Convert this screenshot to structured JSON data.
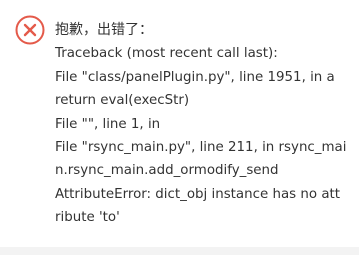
{
  "dialog": {
    "icon": "error-circle-x-icon",
    "icon_color": "#e45a4a",
    "title": "抱歉，出错了：",
    "lines": [
      "Traceback (most recent call last):",
      "File \"class/panelPlugin.py\", line 1951, in a",
      "return eval(execStr)",
      "File \"\", line 1, in",
      "File \"rsync_main.py\", line 211, in rsync_mai",
      "n.rsync_main.add_ormodify_send",
      "AttributeError: dict_obj instance has no att",
      "ribute 'to'"
    ]
  }
}
